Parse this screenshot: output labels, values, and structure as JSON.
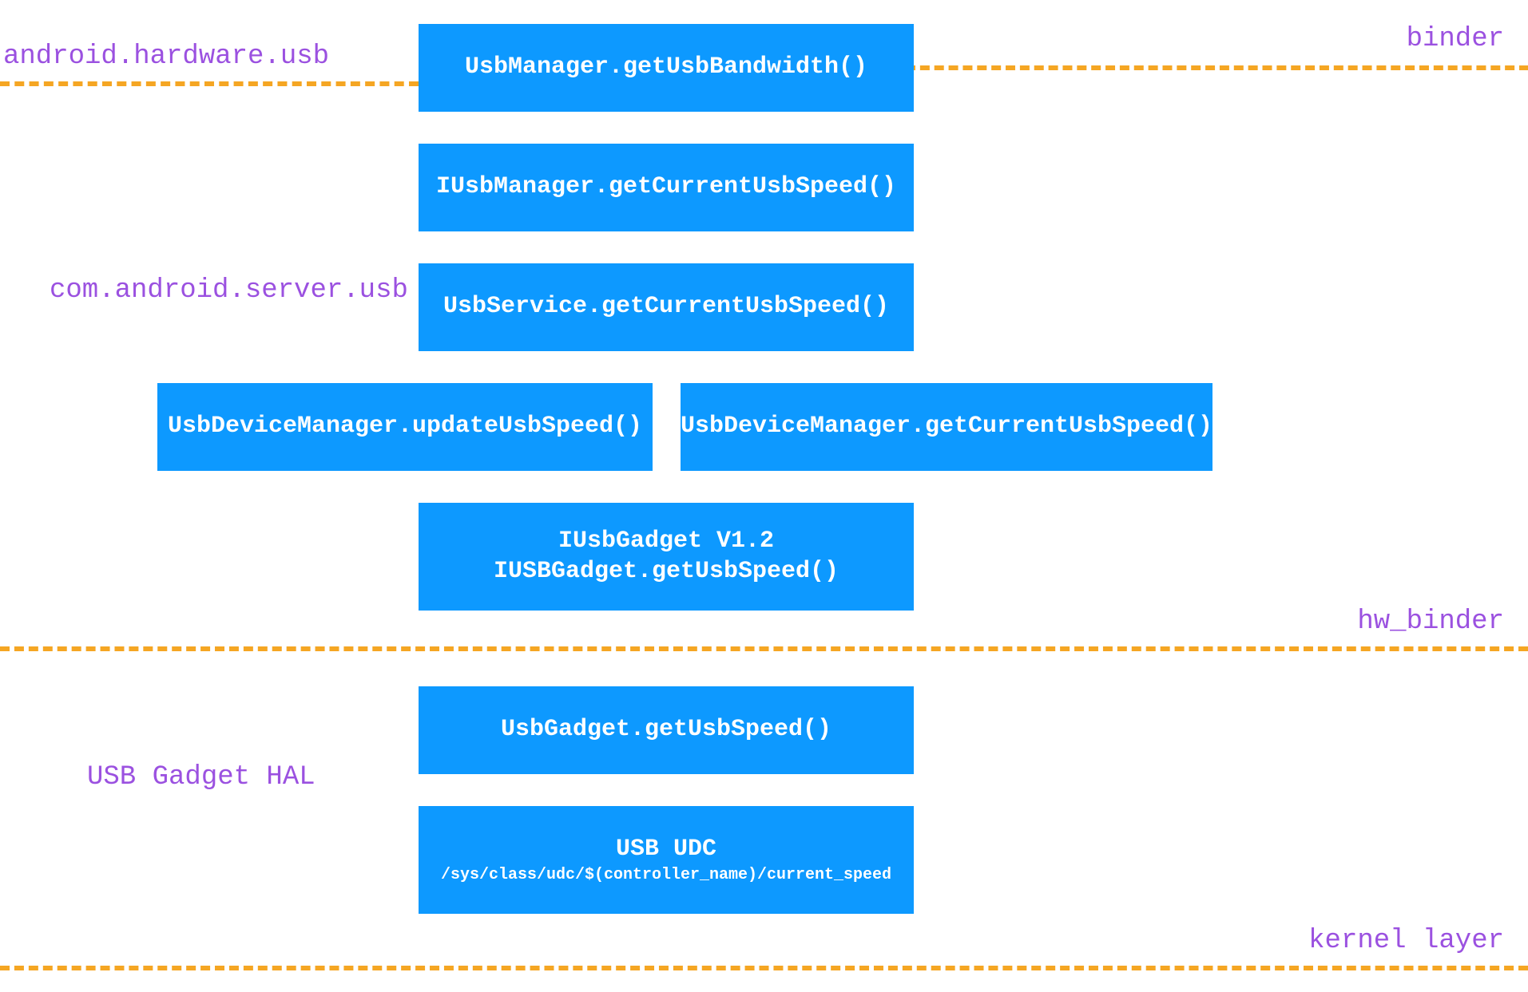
{
  "labels": {
    "android_hw_usb": "android.hardware.usb",
    "binder": "binder",
    "com_android_server_usb": "com.android.server.usb",
    "hw_binder": "hw_binder",
    "usb_gadget_hal": "USB Gadget HAL",
    "kernel_layer": "kernel layer"
  },
  "boxes": {
    "usbmanager_getbandwidth": "UsbManager.getUsbBandwidth()",
    "iusbmanager_getcurrent": "IUsbManager.getCurrentUsbSpeed()",
    "usbservice_getcurrent": "UsbService.getCurrentUsbSpeed()",
    "usbdevmgr_update": "UsbDeviceManager.updateUsbSpeed()",
    "usbdevmgr_getcurrent": "UsbDeviceManager.getCurrentUsbSpeed()",
    "iusbgadget_v12_line1": "IUsbGadget V1.2",
    "iusbgadget_v12_line2": "IUSBGadget.getUsbSpeed()",
    "usbgadget_getspeed": "UsbGadget.getUsbSpeed()",
    "usb_udc_line1": "USB UDC",
    "usb_udc_line2": "/sys/class/udc/$(controller_name)/current_speed"
  }
}
